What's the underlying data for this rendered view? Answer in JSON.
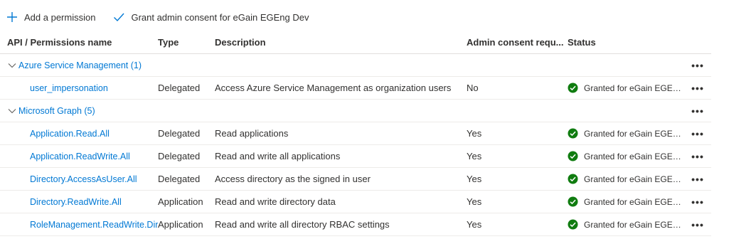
{
  "toolbar": {
    "add_permission_label": "Add a permission",
    "grant_consent_label": "Grant admin consent for eGain EGEng Dev"
  },
  "table": {
    "columns": {
      "name": "API / Permissions name",
      "type": "Type",
      "description": "Description",
      "admin_consent": "Admin consent requ...",
      "status": "Status"
    },
    "groups": [
      {
        "label": "Azure Service Management (1)",
        "items": [
          {
            "name": "user_impersonation",
            "type": "Delegated",
            "description": "Access Azure Service Management as organization users",
            "admin_consent": "No",
            "status": "Granted for eGain EGEn..."
          }
        ]
      },
      {
        "label": "Microsoft Graph (5)",
        "items": [
          {
            "name": "Application.Read.All",
            "type": "Delegated",
            "description": "Read applications",
            "admin_consent": "Yes",
            "status": "Granted for eGain EGEn..."
          },
          {
            "name": "Application.ReadWrite.All",
            "type": "Delegated",
            "description": "Read and write all applications",
            "admin_consent": "Yes",
            "status": "Granted for eGain EGEn..."
          },
          {
            "name": "Directory.AccessAsUser.All",
            "type": "Delegated",
            "description": "Access directory as the signed in user",
            "admin_consent": "Yes",
            "status": "Granted for eGain EGEn..."
          },
          {
            "name": "Directory.ReadWrite.All",
            "type": "Application",
            "description": "Read and write directory data",
            "admin_consent": "Yes",
            "status": "Granted for eGain EGEn..."
          },
          {
            "name": "RoleManagement.ReadWrite.Dir",
            "type": "Application",
            "description": "Read and write all directory RBAC settings",
            "admin_consent": "Yes",
            "status": "Granted for eGain EGEn..."
          }
        ]
      }
    ],
    "more_label": "•••"
  },
  "colors": {
    "accent": "#0078d4",
    "success": "#107c10",
    "text": "#323130",
    "divider": "#edebe9"
  },
  "icons": {
    "add": "plus-icon",
    "grant": "checkmark-icon",
    "group_toggle": "chevron-down-icon",
    "status": "check-circle-icon",
    "more": "more-icon"
  }
}
